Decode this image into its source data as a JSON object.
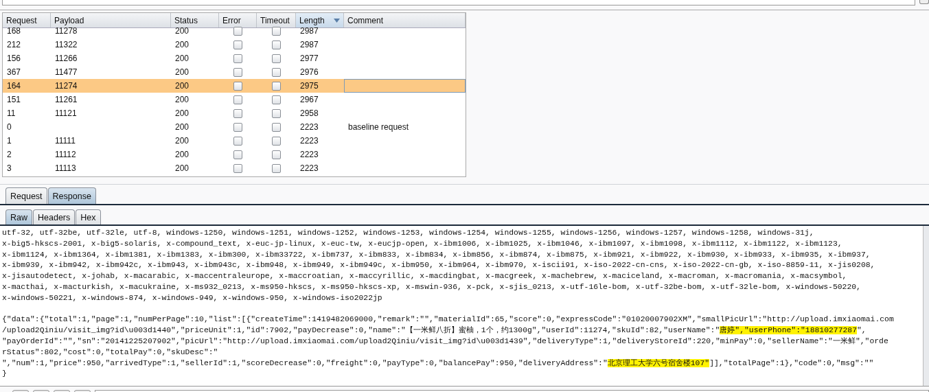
{
  "table": {
    "columns": [
      {
        "label": "Request",
        "sorted": false
      },
      {
        "label": "Payload",
        "sorted": false
      },
      {
        "label": "Status",
        "sorted": false
      },
      {
        "label": "Error",
        "sorted": false
      },
      {
        "label": "Timeout",
        "sorted": false
      },
      {
        "label": "Length",
        "sorted": true
      },
      {
        "label": "Comment",
        "sorted": false
      }
    ],
    "rows": [
      {
        "request": "168",
        "payload": "11278",
        "status": "200",
        "error": false,
        "timeout": false,
        "length": "2987",
        "selected": false
      },
      {
        "request": "212",
        "payload": "11322",
        "status": "200",
        "error": false,
        "timeout": false,
        "length": "2987",
        "selected": false
      },
      {
        "request": "156",
        "payload": "11266",
        "status": "200",
        "error": false,
        "timeout": false,
        "length": "2977",
        "selected": false
      },
      {
        "request": "367",
        "payload": "11477",
        "status": "200",
        "error": false,
        "timeout": false,
        "length": "2976",
        "selected": false
      },
      {
        "request": "164",
        "payload": "11274",
        "status": "200",
        "error": false,
        "timeout": false,
        "length": "2975",
        "selected": true
      },
      {
        "request": "151",
        "payload": "11261",
        "status": "200",
        "error": false,
        "timeout": false,
        "length": "2967",
        "selected": false
      },
      {
        "request": "11",
        "payload": "11121",
        "status": "200",
        "error": false,
        "timeout": false,
        "length": "2958",
        "selected": false
      },
      {
        "request": "0",
        "status": "200",
        "error": false,
        "timeout": false,
        "length": "2223",
        "comment": "baseline request",
        "selected": false
      },
      {
        "request": "1",
        "payload": "11111",
        "status": "200",
        "error": false,
        "timeout": false,
        "length": "2223",
        "selected": false
      },
      {
        "request": "2",
        "payload": "11112",
        "status": "200",
        "error": false,
        "timeout": false,
        "length": "2223",
        "selected": false
      },
      {
        "request": "3",
        "payload": "11113",
        "status": "200",
        "error": false,
        "timeout": false,
        "length": "2223",
        "selected": false
      }
    ]
  },
  "message_tabs": [
    {
      "label": "Request",
      "selected": false
    },
    {
      "label": "Response",
      "selected": true
    }
  ],
  "view_tabs": [
    {
      "label": "Raw",
      "selected": true
    },
    {
      "label": "Headers",
      "selected": false
    },
    {
      "label": "Hex",
      "selected": false
    }
  ],
  "response_lines": [
    [
      {
        "text": "utf-32, utf-32be, utf-32le, utf-8, windows-1250, windows-1251, windows-1252, windows-1253, windows-1254, windows-1255, windows-1256, windows-1257, windows-1258, windows-31j,",
        "highlighted": false
      }
    ],
    [
      {
        "text": "x-big5-hkscs-2001, x-big5-solaris, x-compound_text, x-euc-jp-linux, x-euc-tw, x-eucjp-open, x-ibm1006, x-ibm1025, x-ibm1046, x-ibm1097, x-ibm1098, x-ibm1112, x-ibm1122, x-ibm1123,",
        "highlighted": false
      }
    ],
    [
      {
        "text": "x-ibm1124, x-ibm1364, x-ibm1381, x-ibm1383, x-ibm300, x-ibm33722, x-ibm737, x-ibm833, x-ibm834, x-ibm856, x-ibm874, x-ibm875, x-ibm921, x-ibm922, x-ibm930, x-ibm933, x-ibm935, x-ibm937,",
        "highlighted": false
      }
    ],
    [
      {
        "text": "x-ibm939, x-ibm942, x-ibm942c, x-ibm943, x-ibm943c, x-ibm948, x-ibm949, x-ibm949c, x-ibm950, x-ibm964, x-ibm970, x-iscii91, x-iso-2022-cn-cns, x-iso-2022-cn-gb, x-iso-8859-11, x-jis0208,",
        "highlighted": false
      }
    ],
    [
      {
        "text": "x-jisautodetect, x-johab, x-macarabic, x-maccentraleurope, x-maccroatian, x-maccyrillic, x-macdingbat, x-macgreek, x-machebrew, x-maciceland, x-macroman, x-macromania, x-macsymbol,",
        "highlighted": false
      }
    ],
    [
      {
        "text": "x-macthai, x-macturkish, x-macukraine, x-ms932_0213, x-ms950-hkscs, x-ms950-hkscs-xp, x-mswin-936, x-pck, x-sjis_0213, x-utf-16le-bom, x-utf-32be-bom, x-utf-32le-bom, x-windows-50220,",
        "highlighted": false
      }
    ],
    [
      {
        "text": "x-windows-50221, x-windows-874, x-windows-949, x-windows-950, x-windows-iso2022jp",
        "highlighted": false
      }
    ]
  ],
  "json_lines": [
    [
      {
        "text": "{\"data\":{\"total\":1,\"page\":1,\"numPerPage\":10,\"list\":[{\"createTime\":1419482069000,\"remark\":\"\",\"materialId\":65,\"score\":0,\"expressCode\":\"01020007902XM\",\"smallPicUrl\":\"http://upload.imxiaomai.com",
        "highlighted": false
      }
    ],
    [
      {
        "text": "/upload2Qiniu/visit_img?id\\u003d1440\",\"priceUnit\":1,\"id\":7902,\"payDecrease\":0,\"name\":\"【一米鲜八折】蜜柚，1个，约1300g\",\"userId\":11274,\"skuId\":82,\"userName\":\"",
        "highlighted": false
      },
      {
        "text": "唐婷\",\"userPhone\":\"18810277287",
        "highlighted": true
      },
      {
        "text": "\",",
        "highlighted": false
      }
    ],
    [
      {
        "text": "\"payOrderId\":\"\",\"sn\":\"20141225207902\",\"picUrl\":\"http://upload.imxiaomai.com/upload2Qiniu/visit_img?id\\u003d1439\",\"deliveryType\":1,\"deliveryStoreId\":220,\"minPay\":0,\"sellerName\":\"一米鲜\",\"orde",
        "highlighted": false
      }
    ],
    [
      {
        "text": "rStatus\":802,\"cost\":0,\"totalPay\":0,\"skuDesc\":\"",
        "highlighted": false
      }
    ],
    [
      {
        "text": "\",\"num\":1,\"price\":950,\"arrivedType\":1,\"sellerId\":1,\"scoreDecrease\":0,\"freight\":0,\"payType\":0,\"balancePay\":950,\"deliveryAddress\":\"",
        "highlighted": false
      },
      {
        "text": "北京理工大学六号宿舍楼107\"",
        "highlighted": true
      },
      {
        "text": "]],\"totalPage\":1},\"code\":0,\"msg\":\"\"",
        "highlighted": false
      }
    ],
    [
      {
        "text": "}",
        "highlighted": false
      }
    ]
  ]
}
